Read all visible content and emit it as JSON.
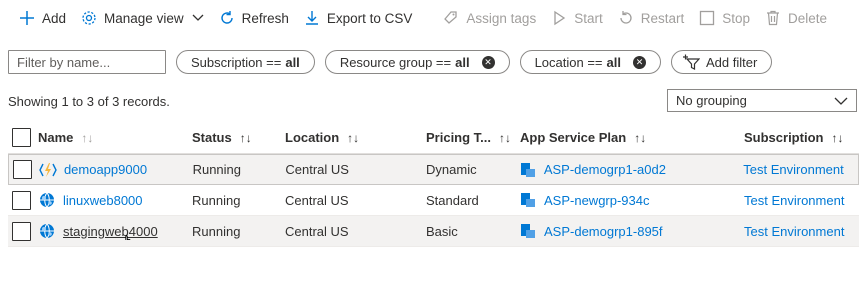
{
  "toolbar": {
    "add": "Add",
    "manage_view": "Manage view",
    "refresh": "Refresh",
    "export": "Export to CSV",
    "assign_tags": "Assign tags",
    "start": "Start",
    "restart": "Restart",
    "stop": "Stop",
    "delete": "Delete",
    "more": "···"
  },
  "filters": {
    "search_placeholder": "Filter by name...",
    "subscription": {
      "label": "Subscription ==",
      "value": "all"
    },
    "resource_group": {
      "label": "Resource group ==",
      "value": "all"
    },
    "location": {
      "label": "Location ==",
      "value": "all"
    },
    "add_filter": "Add filter"
  },
  "records_text": "Showing 1 to 3 of 3 records.",
  "grouping": {
    "selected": "No grouping"
  },
  "table": {
    "headers": {
      "name": "Name",
      "status": "Status",
      "location": "Location",
      "pricing": "Pricing T...",
      "plan": "App Service Plan",
      "subscription": "Subscription"
    },
    "sort_glyph": "↑↓",
    "rows": [
      {
        "name": "demoapp9000",
        "icon": "function-app-icon",
        "status": "Running",
        "location": "Central US",
        "pricing": "Dynamic",
        "plan": "ASP-demogrp1-a0d2",
        "subscription": "Test Environment"
      },
      {
        "name": "linuxweb8000",
        "icon": "web-app-icon",
        "status": "Running",
        "location": "Central US",
        "pricing": "Standard",
        "plan": "ASP-newgrp-934c",
        "subscription": "Test Environment"
      },
      {
        "name": "stagingweb4000",
        "icon": "web-app-icon",
        "status": "Running",
        "location": "Central US",
        "pricing": "Basic",
        "plan": "ASP-demogrp1-895f",
        "subscription": "Test Environment"
      }
    ]
  },
  "colors": {
    "link": "#0078d4",
    "text": "#323130",
    "disabled": "#a19f9d",
    "function": "#f6b73c"
  }
}
